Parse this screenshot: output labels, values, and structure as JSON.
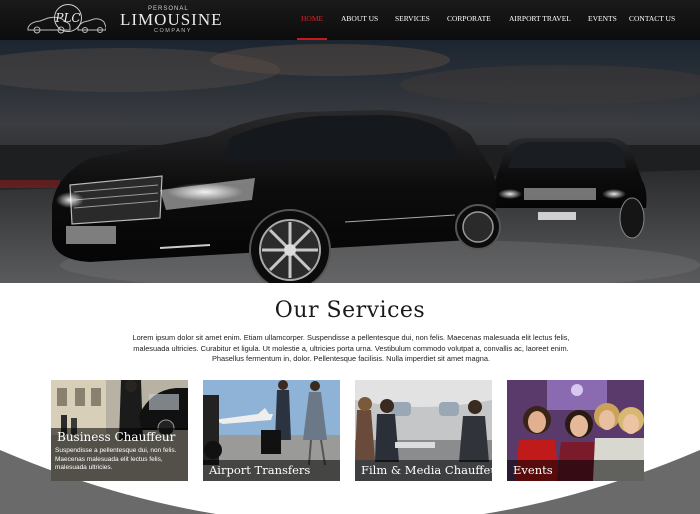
{
  "logo": {
    "top_text": "PERSONAL",
    "main_text": "LIMOUSINE",
    "bottom_text": "COMPANY",
    "emblem": "PLC"
  },
  "nav": {
    "items": [
      {
        "label": "HOME",
        "active": true
      },
      {
        "label": "ABOUT US",
        "active": false
      },
      {
        "label": "SERVICES",
        "active": false
      },
      {
        "label": "CORPORATE",
        "active": false
      },
      {
        "label": "AIRPORT TRAVEL",
        "active": false
      },
      {
        "label": "EVENTS",
        "active": false
      },
      {
        "label": "CONTACT US",
        "active": false
      }
    ]
  },
  "services": {
    "title": "Our Services",
    "text": "Lorem ipsum dolor sit amet enim. Etiam ullamcorper. Suspendisse a pellentesque dui, non felis. Maecenas malesuada elit lectus felis, malesuada ultricies. Curabitur et ligula. Ut molestie a, ultricies porta urna. Vestibulum commodo volutpat a, convallis ac, laoreet enim. Phasellus fermentum in, dolor. Pellentesque facilisis. Nulla imperdiet sit amet magna.",
    "cards": [
      {
        "title": "Business Chauffeur",
        "desc": "Suspendisse a pellentesque dui, non felis. Maecenas malesuada elit lectus felis, malesuada ultricies."
      },
      {
        "title": "Airport Transfers"
      },
      {
        "title": "Film & Media Chauffeur"
      },
      {
        "title": "Events"
      }
    ]
  },
  "colors": {
    "accent": "#c51a1a",
    "header_bg": "#111111",
    "text": "#222222"
  }
}
